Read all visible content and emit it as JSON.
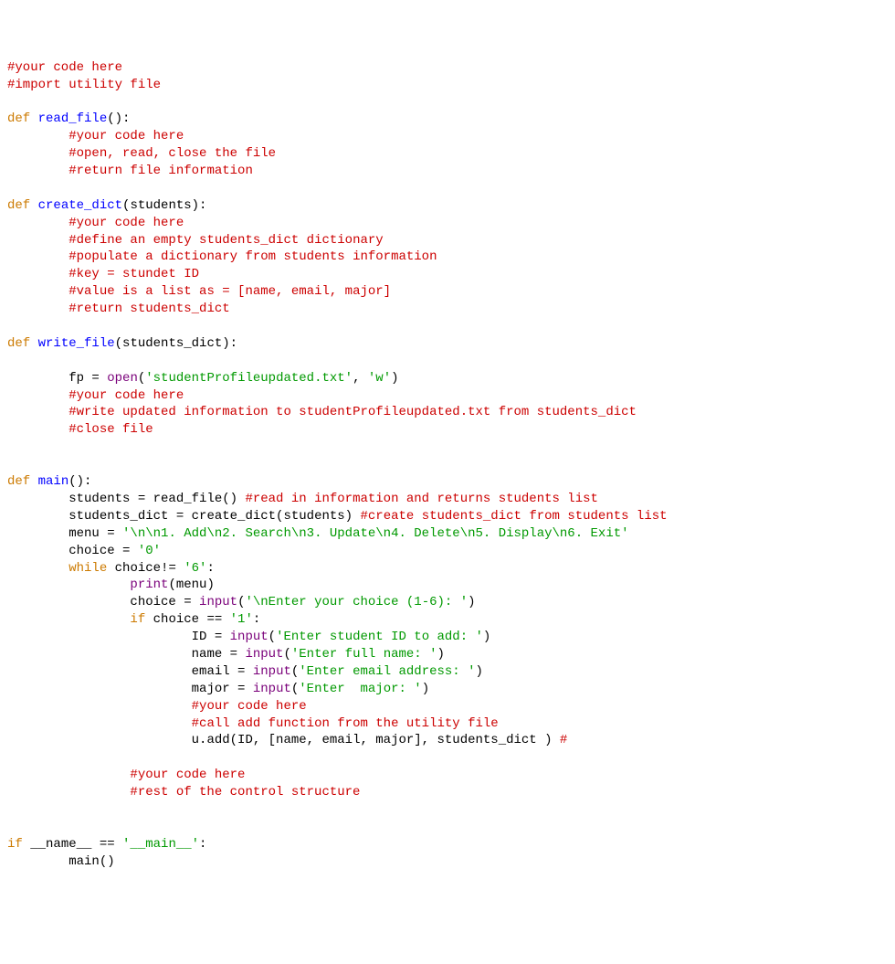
{
  "code": {
    "l1": "#your code here",
    "l2": "#import utility file",
    "l3": "",
    "l4_def": "def",
    "l4_fn": "read_file",
    "l4_rest": "():",
    "l5": "#your code here",
    "l6": "#open, read, close the file",
    "l7": "#return file information",
    "l8": "",
    "l9_def": "def",
    "l9_fn": "create_dict",
    "l9_rest": "(students):",
    "l10": "#your code here",
    "l11": "#define an empty students_dict dictionary",
    "l12": "#populate a dictionary from students information",
    "l13": "#key = stundet ID",
    "l14": "#value is a list as = [name, email, major]",
    "l15": "#return students_dict",
    "l16": "",
    "l17_def": "def",
    "l17_fn": "write_file",
    "l17_rest": "(students_dict):",
    "l18": "",
    "l19a": "fp = ",
    "l19_open": "open",
    "l19_paren1": "(",
    "l19_s1": "'studentProfileupdated.txt'",
    "l19_comma": ", ",
    "l19_s2": "'w'",
    "l19_paren2": ")",
    "l20": "#your code here",
    "l21": "#write updated information to studentProfileupdated.txt from students_dict",
    "l22": "#close file",
    "l23": "",
    "l24": "",
    "l25_def": "def",
    "l25_fn": "main",
    "l25_rest": "():",
    "l26a": "students = read_file() ",
    "l26c": "#read in information and returns students list",
    "l27a": "students_dict = create_dict(students) ",
    "l27c": "#create students_dict from students list",
    "l28a": "menu = ",
    "l28s": "'\\n\\n1. Add\\n2. Search\\n3. Update\\n4. Delete\\n5. Display\\n6. Exit'",
    "l29a": "choice = ",
    "l29s": "'0'",
    "l30_while": "while",
    "l30_rest": " choice!= ",
    "l30_s": "'6'",
    "l30_colon": ":",
    "l31_print": "print",
    "l31_rest": "(menu)",
    "l32a": "choice = ",
    "l32_input": "input",
    "l32_paren1": "(",
    "l32_s": "'\\nEnter your choice (1-6): '",
    "l32_paren2": ")",
    "l33_if": "if",
    "l33_rest": " choice == ",
    "l33_s": "'1'",
    "l33_colon": ":",
    "l34a": "ID = ",
    "l34_input": "input",
    "l34_paren1": "(",
    "l34_s": "'Enter student ID to add: '",
    "l34_paren2": ")",
    "l35a": "name = ",
    "l35_input": "input",
    "l35_paren1": "(",
    "l35_s": "'Enter full name: '",
    "l35_paren2": ")",
    "l36a": "email = ",
    "l36_input": "input",
    "l36_paren1": "(",
    "l36_s": "'Enter email address: '",
    "l36_paren2": ")",
    "l37a": "major = ",
    "l37_input": "input",
    "l37_paren1": "(",
    "l37_s": "'Enter  major: '",
    "l37_paren2": ")",
    "l38": "#your code here",
    "l39": "#call add function from the utility file",
    "l40a": "u.add(ID, [name, email, major], students_dict ) ",
    "l40c": "#",
    "l41": "",
    "l42": "#your code here",
    "l43": "#rest of the control structure",
    "l44": "",
    "l45": "",
    "l46_if": "if",
    "l46_name": " __name__ == ",
    "l46_s": "'__main__'",
    "l46_colon": ":",
    "l47": "main()"
  },
  "indent": {
    "i0": "",
    "i2": "        ",
    "i4": "                ",
    "i6": "                        "
  }
}
